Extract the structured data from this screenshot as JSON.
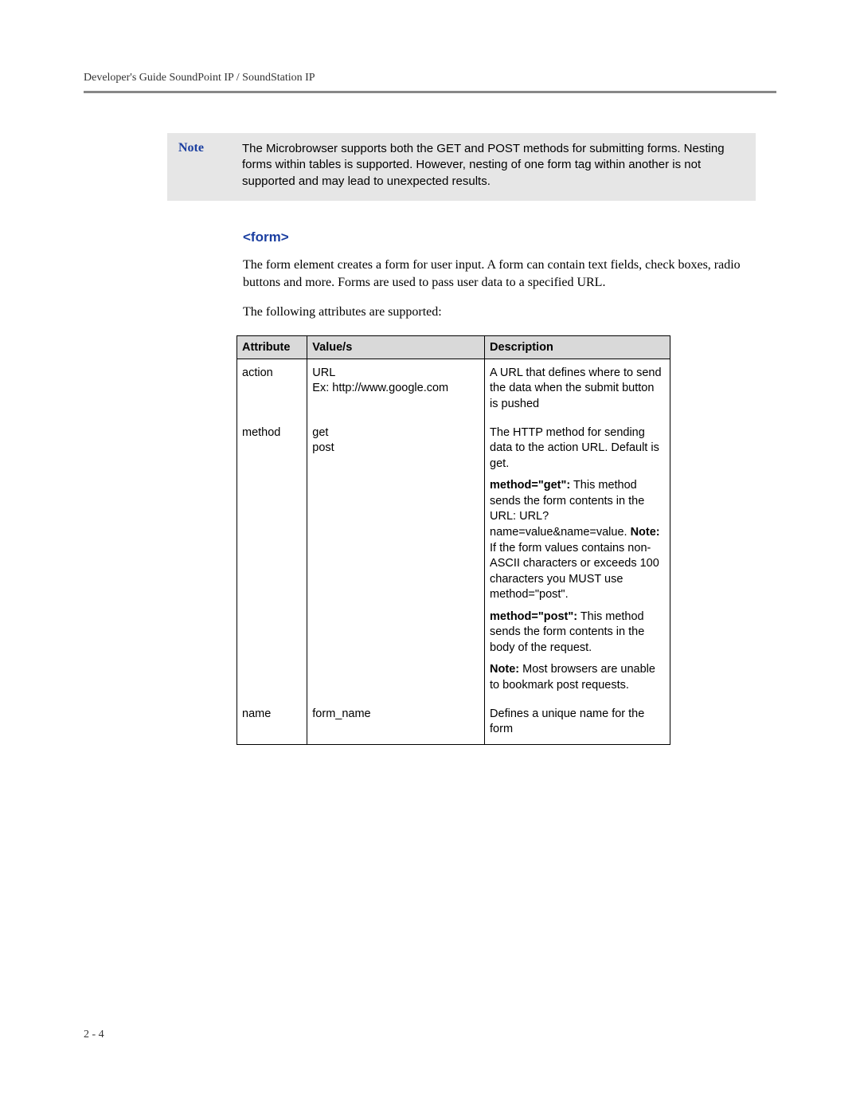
{
  "header": {
    "running_title": "Developer's Guide SoundPoint IP / SoundStation IP"
  },
  "note": {
    "label": "Note",
    "text": "The Microbrowser supports both the GET and POST methods for submitting forms. Nesting forms within tables is supported. However, nesting of one form tag within another is not supported and may lead to unexpected results."
  },
  "section": {
    "heading": "<form>",
    "para1": "The form element creates a form for user input. A form can contain text fields, check boxes, radio buttons and more. Forms are used to pass user data to a specified URL.",
    "para2": "The following attributes are supported:"
  },
  "table": {
    "headers": {
      "attribute": "Attribute",
      "value": "Value/s",
      "description": "Description"
    },
    "rows": {
      "r0": {
        "attr": "action",
        "val_line1": "URL",
        "val_line2": "Ex: http://www.google.com",
        "desc_p0": "A URL that defines where to send the data when the submit button is pushed"
      },
      "r1": {
        "attr": "method",
        "val_line1": "get",
        "val_line2": "post",
        "desc_p0": "The HTTP method for sending data to the action URL. Default is get.",
        "desc_p1_bold": "method=\"get\":",
        "desc_p1_rest": " This method sends the form contents in the URL: URL?name=value&name=value. ",
        "desc_p1_note_bold": "Note:",
        "desc_p1_note_rest": " If the form values contains non-ASCII characters or exceeds 100 characters you MUST use method=\"post\".",
        "desc_p2_bold": "method=\"post\":",
        "desc_p2_rest": " This method sends the form contents in the body of the request.",
        "desc_p3_bold": "Note:",
        "desc_p3_rest": " Most browsers are unable to bookmark post requests."
      },
      "r2": {
        "attr": "name",
        "val": "form_name",
        "desc": "Defines a unique name for the form"
      }
    }
  },
  "footer": {
    "page_number": "2 - 4"
  }
}
